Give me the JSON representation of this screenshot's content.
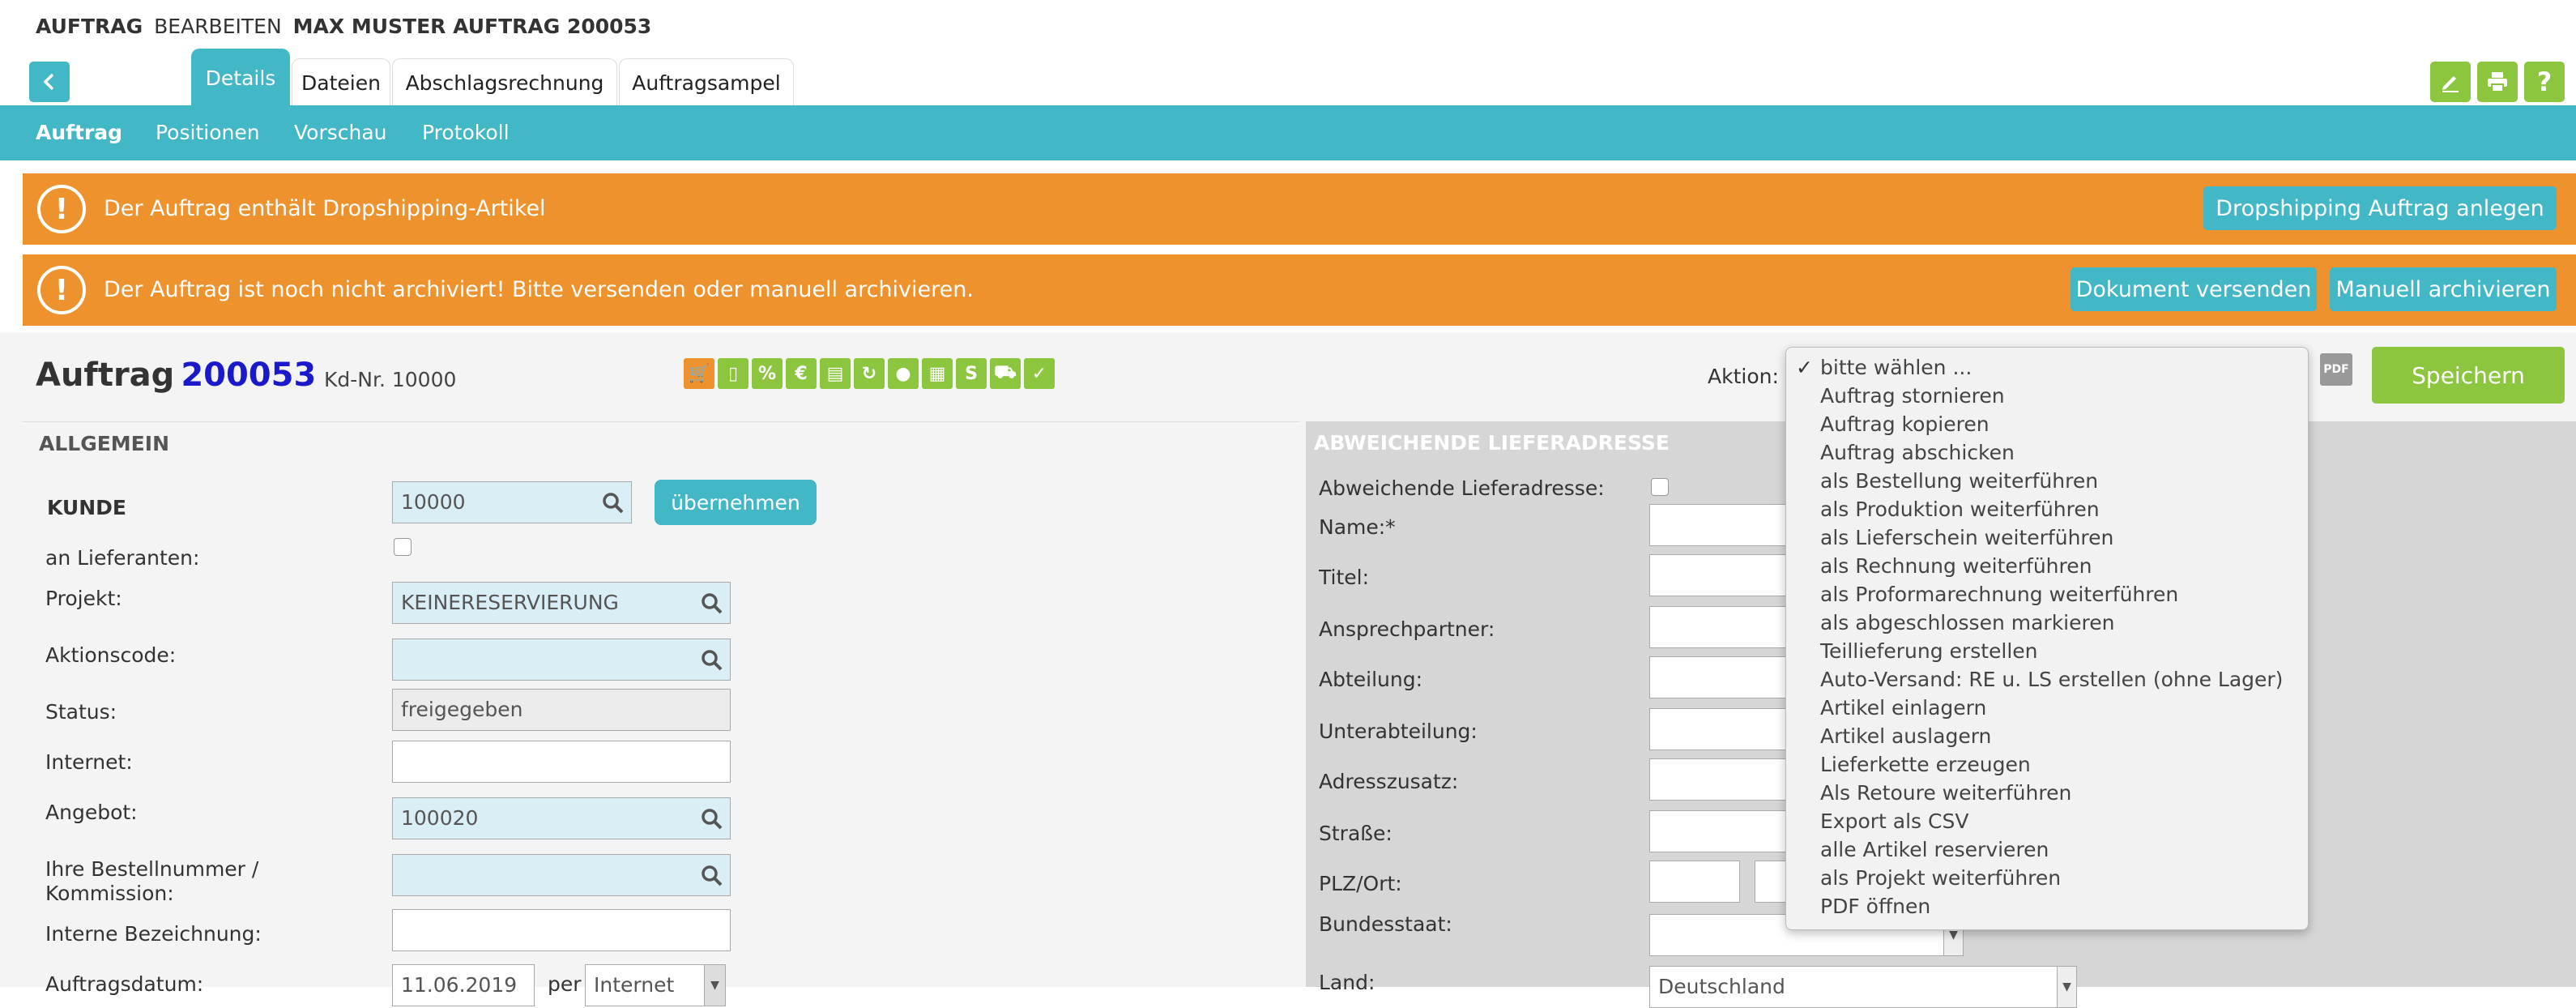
{
  "header": {
    "crumb_1": "AUFTRAG",
    "crumb_2": "BEARBEITEN",
    "crumb_3": "MAX MUSTER AUFTRAG 200053"
  },
  "tabs": [
    {
      "label": "Details"
    },
    {
      "label": "Dateien"
    },
    {
      "label": "Abschlagsrechnung"
    },
    {
      "label": "Auftragsampel"
    }
  ],
  "subnav": [
    {
      "label": "Auftrag"
    },
    {
      "label": "Positionen"
    },
    {
      "label": "Vorschau"
    },
    {
      "label": "Protokoll"
    }
  ],
  "alerts": {
    "dropship_msg": "Der Auftrag enthält Dropshipping-Artikel",
    "dropship_btn": "Dropshipping Auftrag anlegen",
    "archive_msg": "Der Auftrag ist noch nicht archiviert! Bitte versenden oder manuell archivieren.",
    "send_btn": "Dokument versenden",
    "archive_btn": "Manuell archivieren"
  },
  "order": {
    "title_word": "Auftrag",
    "number": "200053",
    "kdnr_label": "Kd-Nr.",
    "kdnr_value": "10000",
    "aktion_label": "Aktion:",
    "save_label": "Speichern",
    "pdf_label": "PDF"
  },
  "left": {
    "heading": "ALLGEMEIN",
    "kunde_label": "KUNDE",
    "kunde_value": "10000",
    "uebernehmen": "übernehmen",
    "an_lieferanten_label": "an Lieferanten:",
    "projekt_label": "Projekt:",
    "projekt_value": "KEINERESERVIERUNG",
    "aktionscode_label": "Aktionscode:",
    "status_label": "Status:",
    "status_value": "freigegeben",
    "internet_label": "Internet:",
    "angebot_label": "Angebot:",
    "angebot_value": "100020",
    "bestellnummer_label_1": "Ihre Bestellnummer /",
    "bestellnummer_label_2": "Kommission:",
    "interne_label": "Interne Bezeichnung:",
    "auftragsdatum_label": "Auftragsdatum:",
    "auftragsdatum_value": "11.06.2019",
    "per_label": "per",
    "per_value": "Internet"
  },
  "right": {
    "heading": "ABWEICHENDE LIEFERADRESSE",
    "labels": [
      "Abweichende Lieferadresse:",
      "Name:*",
      "Titel:",
      "Ansprechpartner:",
      "Abteilung:",
      "Unterabteilung:",
      "Adresszusatz:",
      "Straße:",
      "PLZ/Ort:",
      "Bundesstaat:",
      "Land:"
    ],
    "land_value": "Deutschland"
  },
  "dropdown": {
    "items": [
      "bitte wählen ...",
      "Auftrag stornieren",
      "Auftrag kopieren",
      "Auftrag abschicken",
      "als Bestellung weiterführen",
      "als Produktion weiterführen",
      "als Lieferschein weiterführen",
      "als Rechnung weiterführen",
      "als Proformarechnung weiterführen",
      "als abgeschlossen markieren",
      "Teillieferung erstellen",
      "Auto-Versand: RE u. LS erstellen (ohne Lager)",
      "Artikel einlagern",
      "Artikel auslagern",
      "Lieferkette erzeugen",
      "Als Retoure weiterführen",
      "Export als CSV",
      "alle Artikel reservieren",
      "als Projekt weiterführen",
      "PDF öffnen"
    ],
    "selected_mark": "✓"
  },
  "status_icons": [
    {
      "name": "cart-icon",
      "glyph": "🛒",
      "color": "#ee922d"
    },
    {
      "name": "stock-icon",
      "glyph": "▯",
      "color": "#8cc63f"
    },
    {
      "name": "percent-icon",
      "glyph": "%",
      "color": "#8cc63f"
    },
    {
      "name": "euro-icon",
      "glyph": "€",
      "color": "#8cc63f"
    },
    {
      "name": "invoice-icon",
      "glyph": "▤",
      "color": "#8cc63f"
    },
    {
      "name": "refresh-icon",
      "glyph": "↻",
      "color": "#8cc63f"
    },
    {
      "name": "person-icon",
      "glyph": "●",
      "color": "#8cc63f"
    },
    {
      "name": "calendar-icon",
      "glyph": "▦",
      "color": "#8cc63f"
    },
    {
      "name": "s-icon",
      "glyph": "S",
      "color": "#8cc63f"
    },
    {
      "name": "truck-icon",
      "glyph": "⛟",
      "color": "#8cc63f"
    },
    {
      "name": "check-icon",
      "glyph": "✓",
      "color": "#8cc63f"
    }
  ],
  "colors": {
    "teal": "#42b7c6",
    "orange": "#ee922d",
    "green": "#8cc63f",
    "link_blue": "#1a1acc"
  }
}
